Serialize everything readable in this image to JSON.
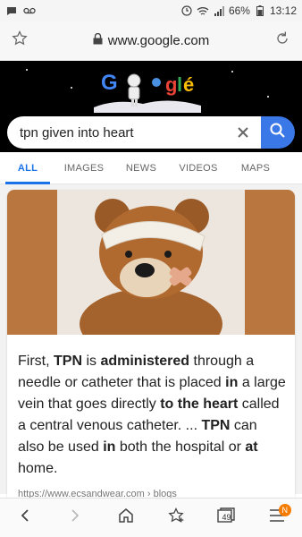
{
  "status_bar": {
    "battery": "66%",
    "time": "13:12",
    "icons": [
      "message-icon",
      "voicemail-icon",
      "sync-icon",
      "wifi-icon",
      "signal-icon",
      "battery-icon"
    ]
  },
  "address_bar": {
    "url": "www.google.com",
    "icons": [
      "star-icon",
      "lock-icon",
      "reload-icon"
    ]
  },
  "doodle": {
    "label": "Google doodle"
  },
  "search": {
    "query": "tpn given into heart",
    "icons": [
      "clear-icon",
      "search-icon"
    ]
  },
  "tabs": [
    {
      "label": "ALL",
      "active": true
    },
    {
      "label": "IMAGES",
      "active": false
    },
    {
      "label": "NEWS",
      "active": false
    },
    {
      "label": "VIDEOS",
      "active": false
    },
    {
      "label": "MAPS",
      "active": false
    }
  ],
  "result": {
    "snippet_parts": [
      {
        "t": "First, ",
        "b": false
      },
      {
        "t": "TPN",
        "b": true
      },
      {
        "t": " is ",
        "b": false
      },
      {
        "t": "administered",
        "b": true
      },
      {
        "t": " through a needle or catheter that is placed ",
        "b": false
      },
      {
        "t": "in",
        "b": true
      },
      {
        "t": " a large vein that goes directly ",
        "b": false
      },
      {
        "t": "to the heart",
        "b": true
      },
      {
        "t": " called a central venous catheter. ... ",
        "b": false
      },
      {
        "t": "TPN",
        "b": true
      },
      {
        "t": " can also be used ",
        "b": false
      },
      {
        "t": "in",
        "b": true
      },
      {
        "t": " both the hospital or ",
        "b": false
      },
      {
        "t": "at",
        "b": true
      },
      {
        "t": " home.",
        "b": false
      }
    ],
    "source": "https://www.ecsandwear.com › blogs"
  },
  "bottom_nav": {
    "tab_count": "49",
    "badge": "N",
    "icons": [
      "back-icon",
      "forward-icon",
      "home-icon",
      "bookmarks-icon",
      "tabs-icon",
      "menu-icon"
    ]
  },
  "colors": {
    "accent": "#1a73e8",
    "search_button": "#3b78e7",
    "image_panel": "#b9763e",
    "badge": "#f57c00"
  }
}
